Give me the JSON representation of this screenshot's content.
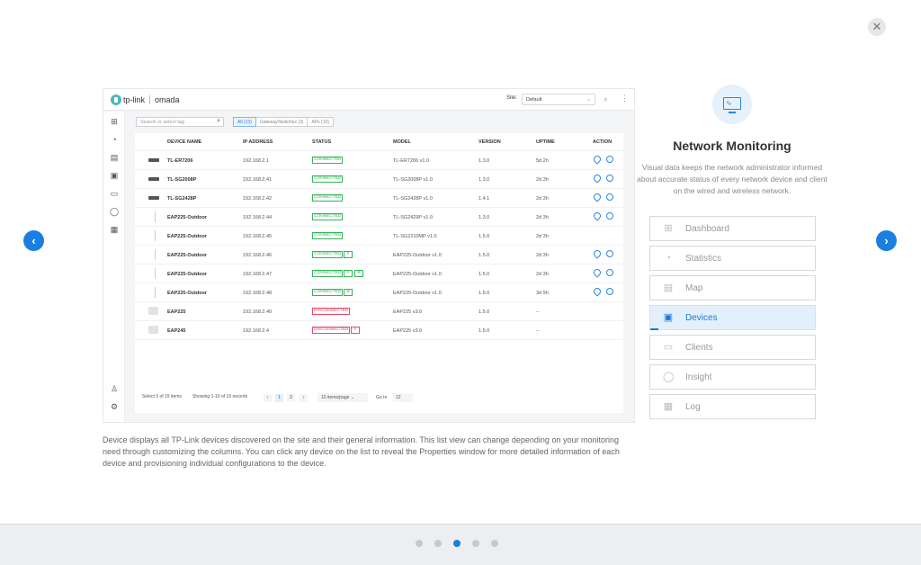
{
  "close_symbol": "✕",
  "nav": {
    "prev_symbol": "‹",
    "next_symbol": "›"
  },
  "shot": {
    "logo": {
      "brand": "tp-link",
      "product": "omada"
    },
    "site_label": "Site:",
    "site_value": "Default",
    "search_placeholder": "Search or select tag",
    "filters": [
      "All (13)",
      "Gateway/Switches (3)",
      "APs (10)"
    ],
    "columns": [
      "DEVICE NAME",
      "IP ADDRESS",
      "STATUS",
      "MODEL",
      "VERSION",
      "UPTIME",
      "ACTION"
    ],
    "rows": [
      {
        "name": "TL-ER7206",
        "ip": "192.168.2.1",
        "status": "CONNECTED",
        "model": "TL-ER7206 v1.0",
        "version": "1.3.0",
        "uptime": "5d 2h"
      },
      {
        "name": "TL-SG2008P",
        "ip": "192.168.2.41",
        "status": "CONNECTED",
        "model": "TL-SG2008P v1.0",
        "version": "1.3.0",
        "uptime": "2d 3h"
      },
      {
        "name": "TL-SG2428P",
        "ip": "192.168.2.42",
        "status": "CONNECTED",
        "model": "TL-SG2428P v1.0",
        "version": "1.4.1",
        "uptime": "2d 3h"
      },
      {
        "name": "EAP225-Outdoor",
        "ip": "192.168.2.44",
        "status": "CONNECTED",
        "model": "TL-SG2429P v1.0",
        "version": "1.3.0",
        "uptime": "2d 3h"
      },
      {
        "name": "EAP225-Outdoor",
        "ip": "192.168.2.45",
        "status": "CONNECTED",
        "model": "TL-SG2210MP v1.0",
        "version": "1.5.0",
        "uptime": "2d 3h"
      },
      {
        "name": "EAP225-Outdoor",
        "ip": "192.168.2.46",
        "status": "CONNECTED",
        "model": "EAP225-Outdoor v1.0",
        "version": "1.5.0",
        "uptime": "2d 3h"
      },
      {
        "name": "EAP225-Outdoor",
        "ip": "192.168.2.47",
        "status": "CONNECTED",
        "model": "EAP225-Outdoor v1.0",
        "version": "1.5.0",
        "uptime": "2d 3h"
      },
      {
        "name": "EAP225-Outdoor",
        "ip": "192.168.2.48",
        "status": "CONNECTED",
        "model": "EAP225-Outdoor v1.0",
        "version": "1.5.0",
        "uptime": "3d 9h"
      },
      {
        "name": "EAP225",
        "ip": "192.168.2.40",
        "status": "DISCONNECTED",
        "model": "EAP225 v3.0",
        "version": "1.5.0",
        "uptime": "--"
      },
      {
        "name": "EAP245",
        "ip": "192.168.2.4",
        "status": "DISCONNECTED",
        "model": "EAP225 v3.0",
        "version": "1.5.0",
        "uptime": "--"
      }
    ],
    "footer": {
      "selected": "Select 3 of 19 items",
      "showing": "Showing 1-10 of 19 records",
      "pages": [
        "1",
        "2"
      ],
      "prev": "‹",
      "next": "›",
      "per_page": "10 items/page",
      "goto_label": "Go to",
      "goto_value": "12"
    }
  },
  "description": "Device displays all TP-Link devices discovered on the site and their general information. This list view can change depending on your monitoring need through customizing the columns. You can click any device on the list to reveal the Properties window for more detailed information of each device and provisioning individual configurations to the device.",
  "feature": {
    "title": "Network Monitoring",
    "description": "Visual data keeps the network administrator informed about accurate status of every network device and client on the wired and wireless network."
  },
  "menu": [
    {
      "label": "Dashboard",
      "icon": "dashboard-icon",
      "glyph": "⊞"
    },
    {
      "label": "Statistics",
      "icon": "statistics-icon",
      "glyph": "◔"
    },
    {
      "label": "Map",
      "icon": "map-icon",
      "glyph": "▤"
    },
    {
      "label": "Devices",
      "icon": "devices-icon",
      "glyph": "▣"
    },
    {
      "label": "Clients",
      "icon": "clients-icon",
      "glyph": "▭"
    },
    {
      "label": "Insight",
      "icon": "insight-icon",
      "glyph": "◯"
    },
    {
      "label": "Log",
      "icon": "log-icon",
      "glyph": "▦"
    }
  ],
  "active_menu": "Devices",
  "dots_count": 5,
  "active_dot_index": 2,
  "colors": {
    "accent": "#1a7fe0",
    "connected": "#36b45a",
    "disconnected": "#e84a6a"
  }
}
